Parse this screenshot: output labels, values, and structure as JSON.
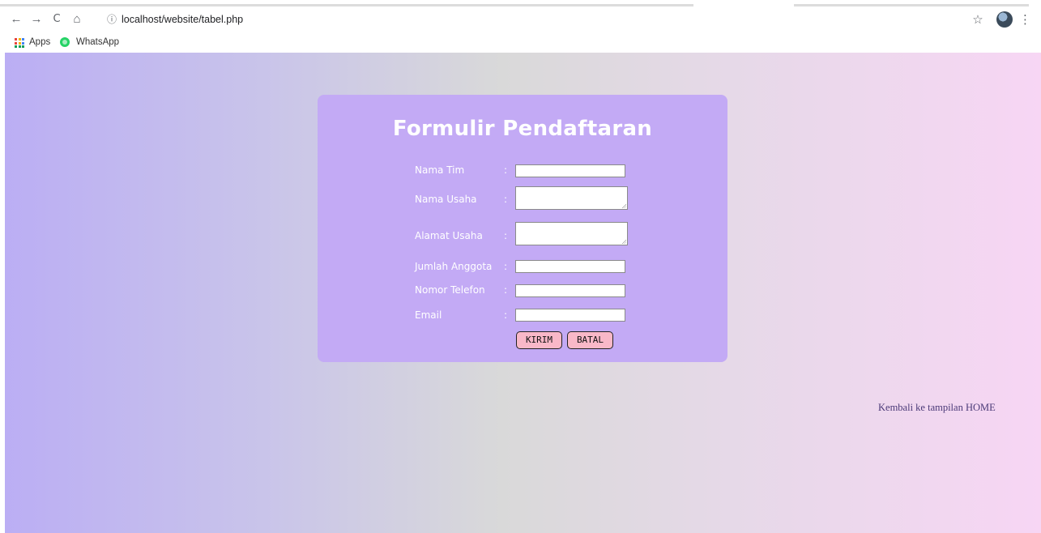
{
  "browser": {
    "url_scheme_icon": "info-icon",
    "url": "localhost/website/tabel.php",
    "nav": {
      "back": "←",
      "forward": "→",
      "reload": "C",
      "home": "⌂"
    },
    "star": "☆",
    "menu": "⋮",
    "bookmarks": [
      {
        "label": "Apps",
        "icon": "apps-grid-icon"
      },
      {
        "label": "WhatsApp",
        "icon": "whatsapp-icon"
      }
    ]
  },
  "form": {
    "title": "Formulir Pendaftaran",
    "fields": [
      {
        "label": "Nama Tim",
        "value": ""
      },
      {
        "label": "Nama Usaha",
        "value": ""
      },
      {
        "label": "Alamat Usaha",
        "value": ""
      },
      {
        "label": "Jumlah Anggota",
        "value": ""
      },
      {
        "label": "Nomor Telefon",
        "value": ""
      },
      {
        "label": "Email",
        "value": ""
      }
    ],
    "colon": ":",
    "submit_label": "KIRIM",
    "cancel_label": "BATAL"
  },
  "footer": {
    "home_link": "Kembali ke tampilan HOME"
  },
  "colors": {
    "card_bg": "#c3aaf5",
    "button_bg": "#f9b8c8",
    "gradient_left": "#bbaef4",
    "gradient_right": "#f7d6f4"
  }
}
